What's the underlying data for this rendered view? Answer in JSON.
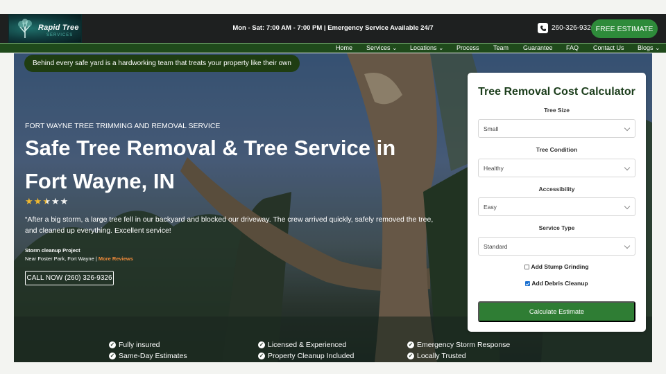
{
  "header": {
    "logo": {
      "brand": "Rapid Tree",
      "sub": "SERVICES"
    },
    "hours": "Mon - Sat: 7:00 AM - 7:00 PM | Emergency Service Available 24/7",
    "phone": "260-326-9326",
    "cta_label": "FREE ESTIMATE",
    "phone_icon": "phone-icon"
  },
  "nav": {
    "items": [
      {
        "label": "Home"
      },
      {
        "label": "Services ⌄"
      },
      {
        "label": "Locations ⌄"
      },
      {
        "label": "Process"
      },
      {
        "label": "Team"
      },
      {
        "label": "Guarantee"
      },
      {
        "label": "FAQ"
      },
      {
        "label": "Contact Us"
      },
      {
        "label": "Blogs ⌄"
      }
    ]
  },
  "hero": {
    "tagline": "Behind every safe yard is a hardworking team that treats your property like their own",
    "eyebrow": "FORT WAYNE TREE TRIMMING AND REMOVAL SERVICE",
    "headline": "Safe Tree Removal & Tree Service in Fort Wayne, IN",
    "rating": 2.5,
    "rating_max": 5,
    "quote": "“After a big storm, a large tree fell in our backyard and blocked our driveway. The crew arrived quickly, safely removed the tree, and cleaned up everything. Excellent service!",
    "project": "Storm cleanup Project",
    "location": "Near Foster Park, Fort Wayne |",
    "more_reviews": "More Reviews",
    "call_label": "CALL NOW (260) 326-9326"
  },
  "features": [
    "Fully insured",
    "Licensed & Experienced",
    "Emergency Storm Response",
    "Same-Day Estimates",
    "Property Cleanup Included",
    "Locally Trusted"
  ],
  "calculator": {
    "title": "Tree Removal Cost Calculator",
    "tree_size_label": "Tree Size",
    "tree_size_value": "Small",
    "condition_label": "Tree Condition",
    "condition_value": "Healthy",
    "access_label": "Accessibility",
    "access_value": "Easy",
    "service_label": "Service Type",
    "service_value": "Standard",
    "stump_label": "Add Stump Grinding",
    "stump_checked": false,
    "debris_label": "Add Debris Cleanup",
    "debris_checked": true,
    "button_label": "Calculate Estimate"
  }
}
